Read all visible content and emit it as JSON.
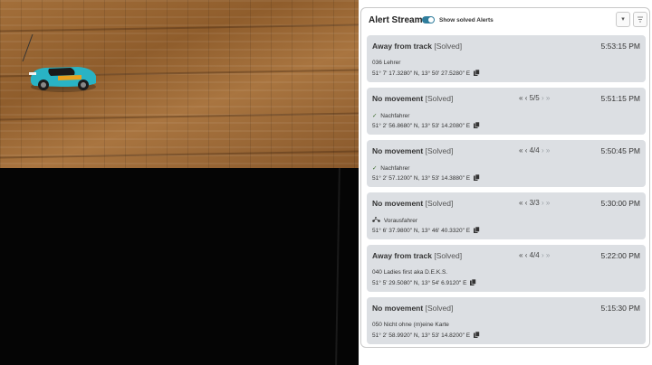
{
  "panel": {
    "title": "Alert Stream:",
    "toggle_label": "Show solved Alerts",
    "toggle_on": true,
    "accent": "#2f7d9c",
    "buttons": {
      "dropdown_icon": "chevron-down-icon",
      "filter_icon": "sort-filter-icon"
    }
  },
  "alerts": [
    {
      "type": "Away from track",
      "status": "[Solved]",
      "time": "5:53:15 PM",
      "has_pager": false,
      "pager": "",
      "driver_icon": "",
      "driver": "036 Lehrer",
      "coords": "51° 7' 17.3280\" N, 13° 50' 27.5280\" E"
    },
    {
      "type": "No movement",
      "status": "[Solved]",
      "time": "5:51:15 PM",
      "has_pager": true,
      "pager": "5/5",
      "driver_icon": "check-icon",
      "driver": "Nachfahrer",
      "coords": "51° 2' 56.8680\" N, 13° 53' 14.2080\" E"
    },
    {
      "type": "No movement",
      "status": "[Solved]",
      "time": "5:50:45 PM",
      "has_pager": true,
      "pager": "4/4",
      "driver_icon": "check-icon",
      "driver": "Nachfahrer",
      "coords": "51° 2' 57.1200\" N, 13° 53' 14.3880\" E"
    },
    {
      "type": "No movement",
      "status": "[Solved]",
      "time": "5:30:00 PM",
      "has_pager": true,
      "pager": "3/3",
      "driver_icon": "scooter-icon",
      "driver": "Vorausfahrer",
      "coords": "51° 6' 37.9800\" N, 13° 46' 40.3320\" E"
    },
    {
      "type": "Away from track",
      "status": "[Solved]",
      "time": "5:22:00 PM",
      "has_pager": true,
      "pager": "4/4",
      "driver_icon": "",
      "driver": "040 Ladies first aka D.E.K.S.",
      "coords": "51° 5' 29.5080\" N, 13° 54' 6.9120\" E"
    },
    {
      "type": "No movement",
      "status": "[Solved]",
      "time": "5:15:30 PM",
      "has_pager": false,
      "pager": "",
      "driver_icon": "",
      "driver": "050 Nicht ohne (m)eine Karte",
      "coords": "51° 2' 58.9920\" N, 13° 53' 14.8200\" E"
    }
  ]
}
